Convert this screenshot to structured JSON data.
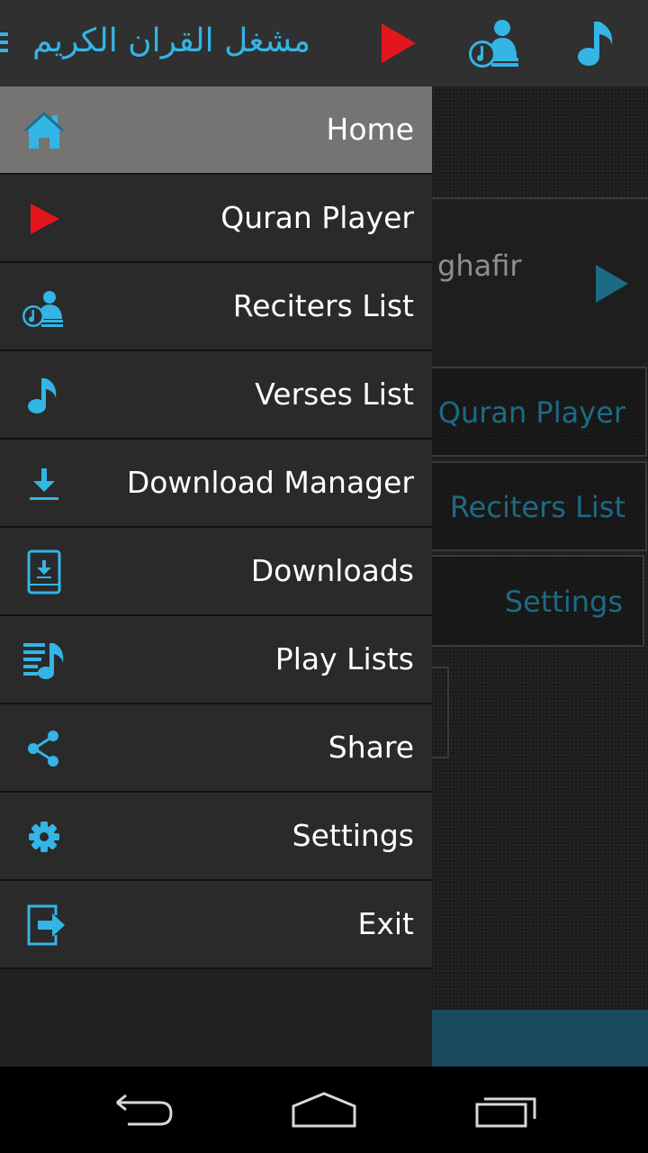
{
  "app": {
    "title": "مشغل القران الكريم"
  },
  "colors": {
    "accent": "#33b5e5",
    "play_red": "#e3161d",
    "selected_item": "#767472"
  },
  "actionbar": {
    "icons": [
      "menu-icon",
      "play-icon",
      "reciter-icon",
      "music-note-icon"
    ]
  },
  "drawer": {
    "items": [
      {
        "label": "Home",
        "icon": "home-icon",
        "selected": true
      },
      {
        "label": "Quran Player",
        "icon": "play-icon",
        "selected": false
      },
      {
        "label": "Reciters List",
        "icon": "reciter-icon",
        "selected": false
      },
      {
        "label": "Verses List",
        "icon": "music-note-icon",
        "selected": false
      },
      {
        "label": "Download Manager",
        "icon": "download-icon",
        "selected": false
      },
      {
        "label": "Downloads",
        "icon": "downloads-folder-icon",
        "selected": false
      },
      {
        "label": "Play Lists",
        "icon": "playlist-icon",
        "selected": false
      },
      {
        "label": "Share",
        "icon": "share-icon",
        "selected": false
      },
      {
        "label": "Settings",
        "icon": "gear-icon",
        "selected": false
      },
      {
        "label": "Exit",
        "icon": "exit-icon",
        "selected": false
      }
    ]
  },
  "content": {
    "now_playing_text": "ghafir",
    "buttons": [
      "Quran Player",
      "Reciters List",
      "Settings"
    ]
  },
  "system_nav": {
    "icons": [
      "back-icon",
      "home-button-icon",
      "recent-apps-icon"
    ]
  }
}
